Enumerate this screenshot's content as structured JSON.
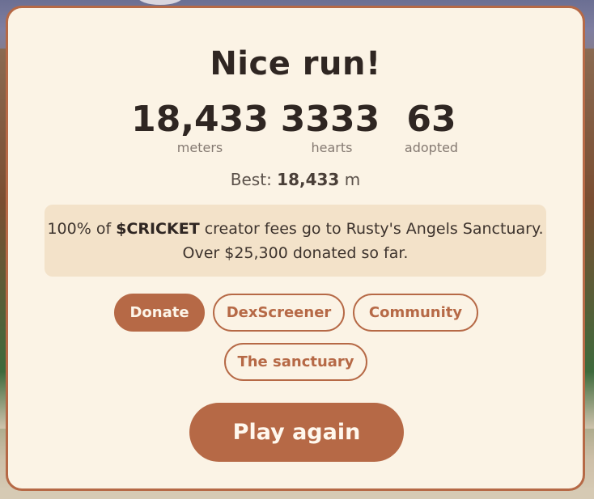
{
  "overlay": {
    "title": "Nice run!",
    "stats": [
      {
        "value": "18,433",
        "label": "meters"
      },
      {
        "value": "3333",
        "label": "hearts"
      },
      {
        "value": "63",
        "label": "adopted"
      }
    ],
    "best": {
      "prefix": "Best: ",
      "value": "18,433",
      "unit": " m"
    },
    "info": {
      "line1_prefix": "100% of ",
      "token": "$CRICKET",
      "line1_suffix": " creator fees go to Rusty's Angels Sanctuary.",
      "line2": "Over $25,300 donated so far."
    },
    "links": {
      "donate": "Donate",
      "dexscreener": "DexScreener",
      "community": "Community",
      "sanctuary": "The sanctuary"
    },
    "play_again": "Play again"
  },
  "colors": {
    "accent": "#b66946",
    "card_bg": "#fbf3e5",
    "info_bg": "#f3e2c9",
    "text_dark": "#2f2622",
    "text_muted": "#857a72"
  }
}
